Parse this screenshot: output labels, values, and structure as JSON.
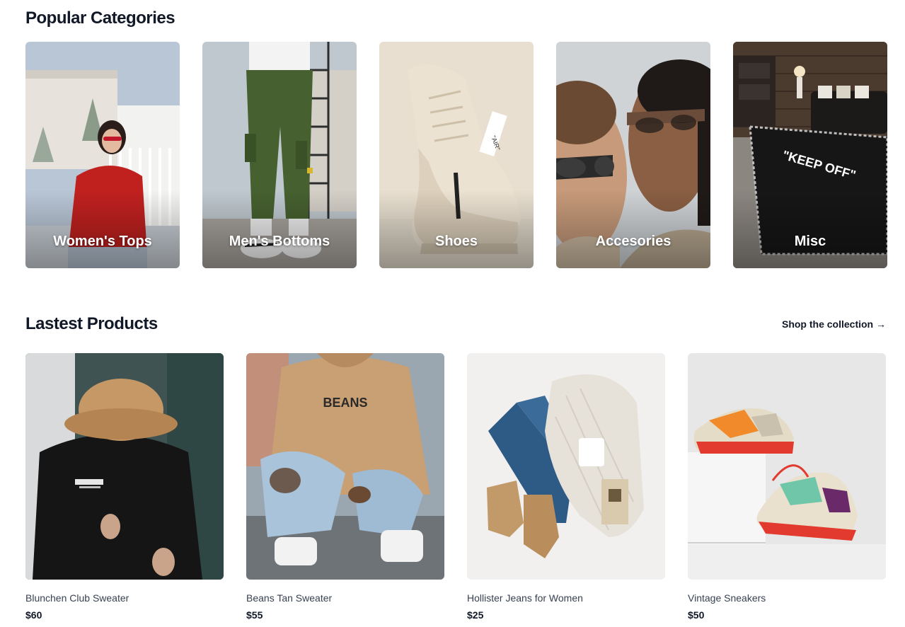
{
  "categories_section": {
    "title": "Popular Categories",
    "items": [
      {
        "label": "Women's Tops"
      },
      {
        "label": "Men's Bottoms"
      },
      {
        "label": "Shoes"
      },
      {
        "label": "Accesories"
      },
      {
        "label": "Misc"
      }
    ]
  },
  "products_section": {
    "title": "Lastest Products",
    "link_label": "Shop the collection →",
    "items": [
      {
        "name": "Blunchen Club Sweater",
        "price": "$60"
      },
      {
        "name": "Beans Tan Sweater",
        "price": "$55"
      },
      {
        "name": "Hollister Jeans for Women",
        "price": "$25"
      },
      {
        "name": "Vintage Sneakers",
        "price": "$50"
      }
    ]
  },
  "rug_text": "\"KEEP OFF\"",
  "hoodie_text": "BEANS"
}
